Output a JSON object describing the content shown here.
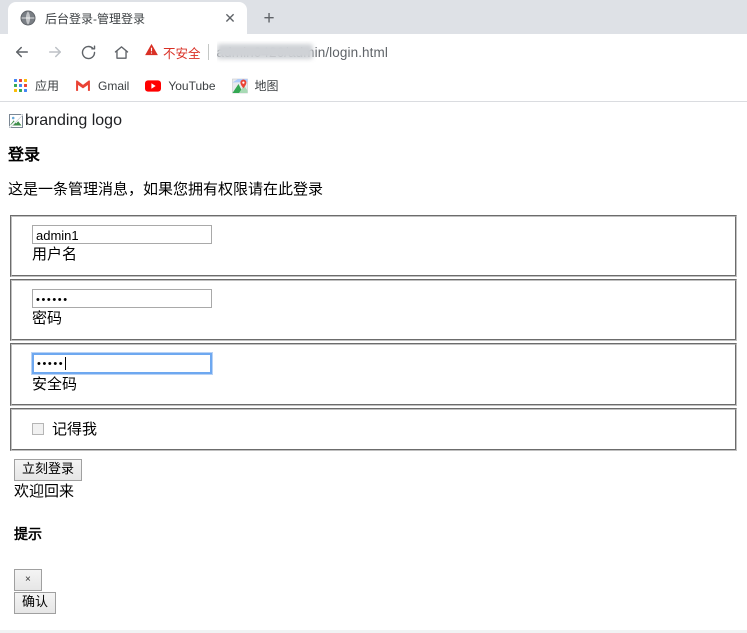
{
  "browser": {
    "tab": {
      "title": "后台登录-管理登录",
      "favicon": "globe-icon",
      "close_label": "✕"
    },
    "new_tab_label": "+",
    "nav": {
      "back": "back-arrow-icon",
      "forward": "forward-arrow-icon",
      "reload": "reload-icon",
      "home": "home-icon"
    },
    "omnibox": {
      "security_label": "不安全",
      "security_icon": "warning-triangle-icon",
      "url": "admin0426/admin/login.html",
      "url_redacted": true
    },
    "bookmarks": [
      {
        "label": "应用",
        "icon": "apps-grid-icon"
      },
      {
        "label": "Gmail",
        "icon": "gmail-icon"
      },
      {
        "label": "YouTube",
        "icon": "youtube-icon"
      },
      {
        "label": "地图",
        "icon": "maps-pin-icon"
      }
    ]
  },
  "page": {
    "logo_alt": "branding logo",
    "logo_icon": "broken-image-icon",
    "heading": "登录",
    "lead_message": "这是一条管理消息，如果您拥有权限请在此登录",
    "fields": [
      {
        "name": "username",
        "value": "admin1",
        "label": "用户名",
        "type": "text",
        "focused": false
      },
      {
        "name": "password",
        "value": "••••••",
        "label": "密码",
        "type": "password",
        "focused": false
      },
      {
        "name": "security-code",
        "value": "•••••",
        "label": "安全码",
        "type": "password",
        "focused": true
      }
    ],
    "remember_me": {
      "label": "记得我",
      "checked": false
    },
    "login_button": "立刻登录",
    "welcome_text": "欢迎回来",
    "tip_heading": "提示",
    "dismiss_button": "×",
    "confirm_button": "确认"
  },
  "colors": {
    "warning_red": "#d93025",
    "tabstrip_bg": "#dee1e6",
    "focus_blue": "#6ea8f0",
    "text_primary": "#202124"
  }
}
